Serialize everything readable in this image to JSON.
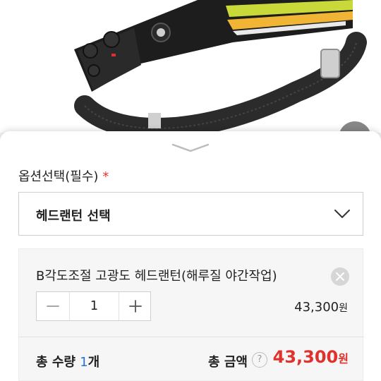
{
  "product_image": {
    "alt": "head lamp product photo"
  },
  "options": {
    "label": "옵션선택(필수)",
    "required_mark": "*",
    "select_value": "헤드랜턴 선택"
  },
  "selected_item": {
    "name": "B각도조절 고광도 헤드랜턴(해루질 야간작업)",
    "quantity": "1",
    "price": "43,300",
    "price_unit": "원"
  },
  "summary": {
    "qty_prefix": "총 수량 ",
    "qty_value": "1",
    "qty_suffix": "개",
    "total_label": "총 금액",
    "help_symbol": "?",
    "total_price": "43,300",
    "total_unit": "원"
  },
  "colors": {
    "accent_red": "#e0322c",
    "qty_blue": "#2b6fd6"
  },
  "icons": [
    "chevron-down-icon",
    "close-icon",
    "minus-icon",
    "plus-icon",
    "help-icon"
  ]
}
